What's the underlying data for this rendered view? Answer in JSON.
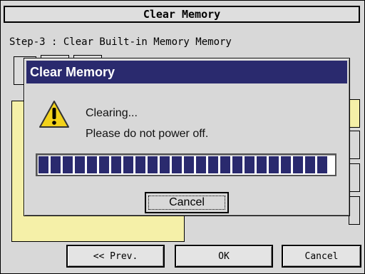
{
  "screen": {
    "title": "Clear Memory",
    "step_label": "Step-3 : Clear Built-in Memory Memory",
    "buttons": {
      "prev": "<< Prev.",
      "ok": "OK",
      "cancel": "Cancel"
    }
  },
  "dialog": {
    "title": "Clear Memory",
    "icon": "warning-icon",
    "message_line1": "Clearing...",
    "message_line2": "Please do not power off.",
    "progress": 1.0,
    "cancel_label": "Cancel"
  },
  "colors": {
    "title_bar": "#2a2a6e",
    "progress": "#2a2a6e",
    "highlight_panel": "#f5f0a8",
    "warning": "#f2d21b"
  }
}
